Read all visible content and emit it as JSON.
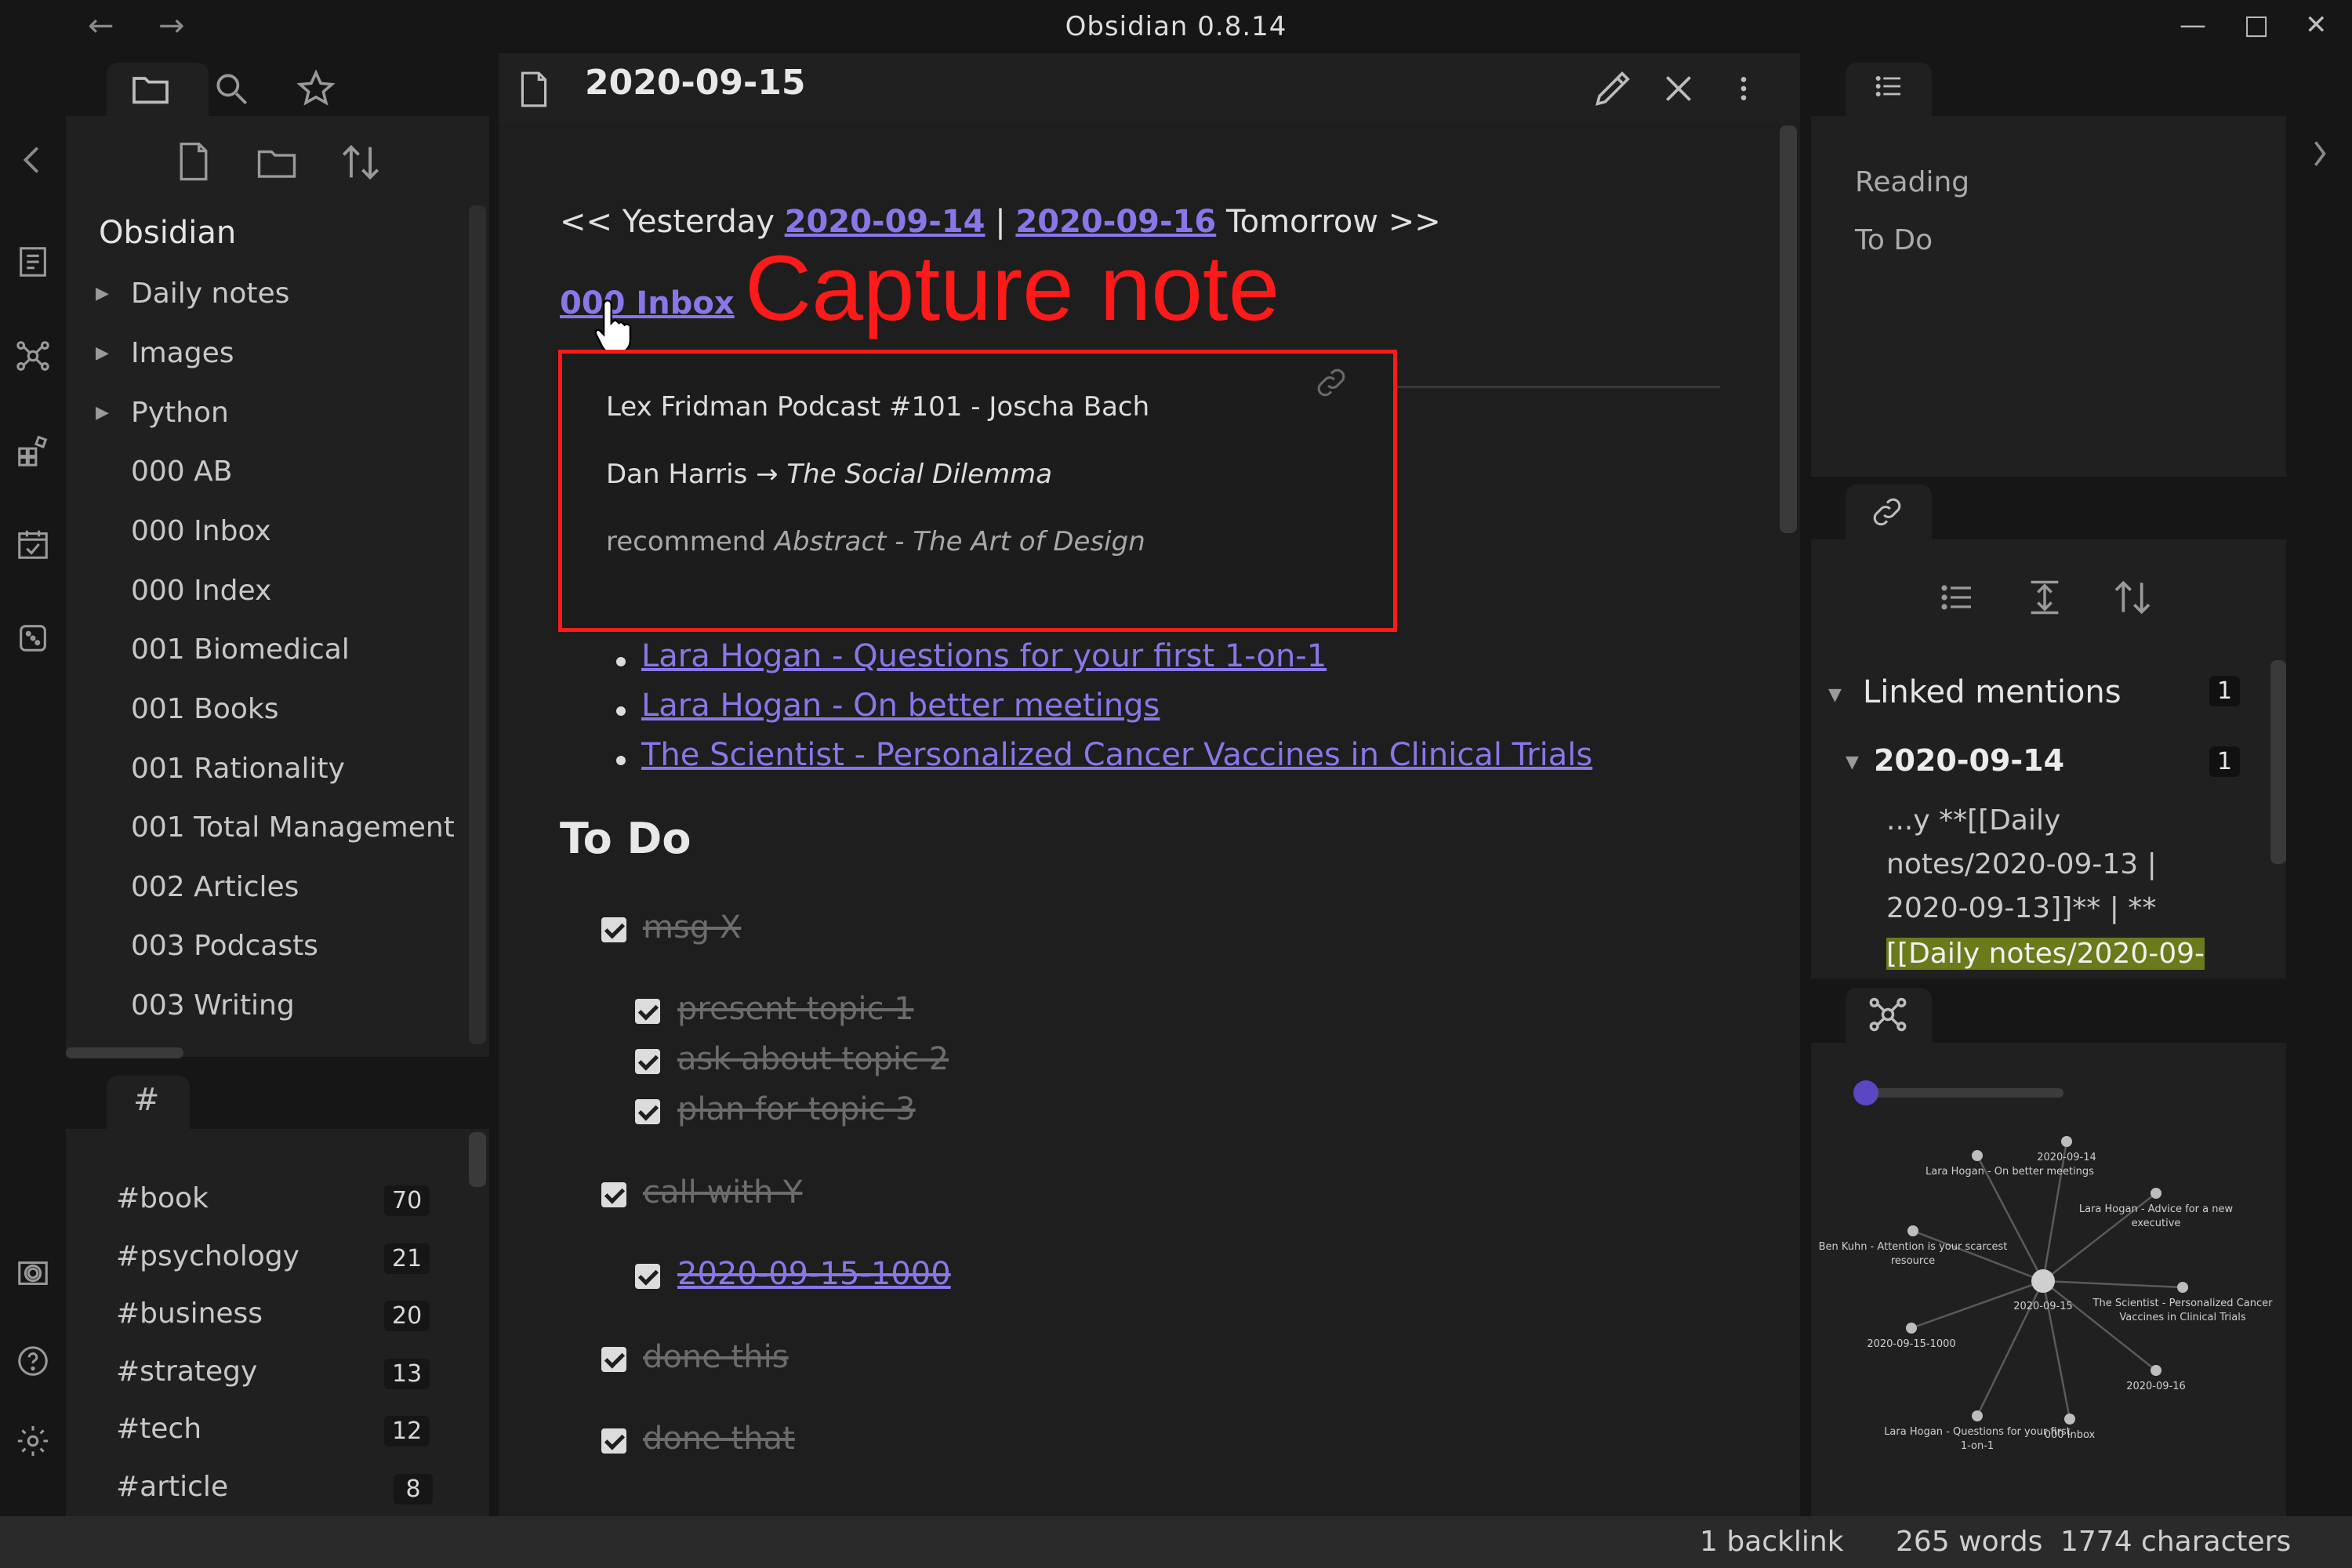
{
  "window": {
    "title": "Obsidian 0.8.14"
  },
  "left_sidebar": {
    "vault_name": "Obsidian",
    "tree": [
      {
        "label": "Daily notes",
        "folder": true
      },
      {
        "label": "Images",
        "folder": true
      },
      {
        "label": "Python",
        "folder": true
      },
      {
        "label": "000 AB"
      },
      {
        "label": "000 Inbox"
      },
      {
        "label": "000 Index"
      },
      {
        "label": "001 Biomedical"
      },
      {
        "label": "001 Books"
      },
      {
        "label": "001 Rationality"
      },
      {
        "label": "001 Total Management"
      },
      {
        "label": "002 Articles"
      },
      {
        "label": "003 Podcasts"
      },
      {
        "label": "003 Writing"
      }
    ],
    "tag_pane_label": "#",
    "tags": [
      {
        "name": "#book",
        "count": "70"
      },
      {
        "name": "#psychology",
        "count": "21"
      },
      {
        "name": "#business",
        "count": "20"
      },
      {
        "name": "#strategy",
        "count": "13"
      },
      {
        "name": "#tech",
        "count": "12"
      },
      {
        "name": "#article",
        "count": "8"
      }
    ]
  },
  "editor": {
    "title": "2020-09-15",
    "nav": {
      "prefix": "<< Yesterday ",
      "prev": "2020-09-14",
      "sep": " | ",
      "next": "2020-09-16",
      "suffix": " Tomorrow >>"
    },
    "inbox_link": "000 Inbox",
    "annotation": "Capture note",
    "popover": {
      "line1": "Lex Fridman Podcast #101 - Joscha Bach",
      "line2_prefix": "Dan Harris → ",
      "line2_italic": "The Social Dilemma",
      "line3_prefix": "recommend ",
      "line3_italic": "Abstract - The Art of Design"
    },
    "links": [
      "Lara Hogan - Questions for your first 1-on-1",
      "Lara Hogan - On better meetings",
      "The Scientist - Personalized Cancer Vaccines in Clinical Trials"
    ],
    "todo_heading": "To Do",
    "todos": [
      {
        "text": "msg X"
      },
      {
        "text": "present topic 1"
      },
      {
        "text": "ask about topic 2"
      },
      {
        "text": "plan for topic 3"
      },
      {
        "text": "call with Y"
      },
      {
        "text": "2020-09-15-1000"
      },
      {
        "text": "done this"
      },
      {
        "text": "done that"
      }
    ]
  },
  "right_sidebar": {
    "outline": [
      "Reading",
      "To Do"
    ],
    "linked_mentions": {
      "label": "Linked mentions",
      "count": "1",
      "file": "2020-09-14",
      "file_count": "1",
      "snippet": [
        "...y **[[Daily",
        "notes/2020-09-13 |",
        "2020-09-13]]** | **"
      ],
      "highlight": "[[Daily notes/2020-09-"
    },
    "graph": {
      "slider_value": 0,
      "nodes": [
        {
          "label": "2020-09-14"
        },
        {
          "label": "Lara Hogan - On better meetings"
        },
        {
          "label": "Lara Hogan - Advice for a new executive"
        },
        {
          "label": "Ben Kuhn - Attention is your scarcest resource"
        },
        {
          "label": "2020-09-15"
        },
        {
          "label": "The Scientist - Personalized Cancer Vaccines in Clinical Trials"
        },
        {
          "label": "2020-09-15-1000"
        },
        {
          "label": "2020-09-16"
        },
        {
          "label": "Lara Hogan - Questions for your first 1-on-1"
        },
        {
          "label": "000 Inbox"
        }
      ]
    }
  },
  "status_bar": {
    "backlinks": "1 backlink",
    "words": "265 words",
    "characters": "1774 characters"
  },
  "colors": {
    "accent": "#8a76e8",
    "annotation": "#ff1a1a",
    "highlight": "#6b7a1a"
  }
}
